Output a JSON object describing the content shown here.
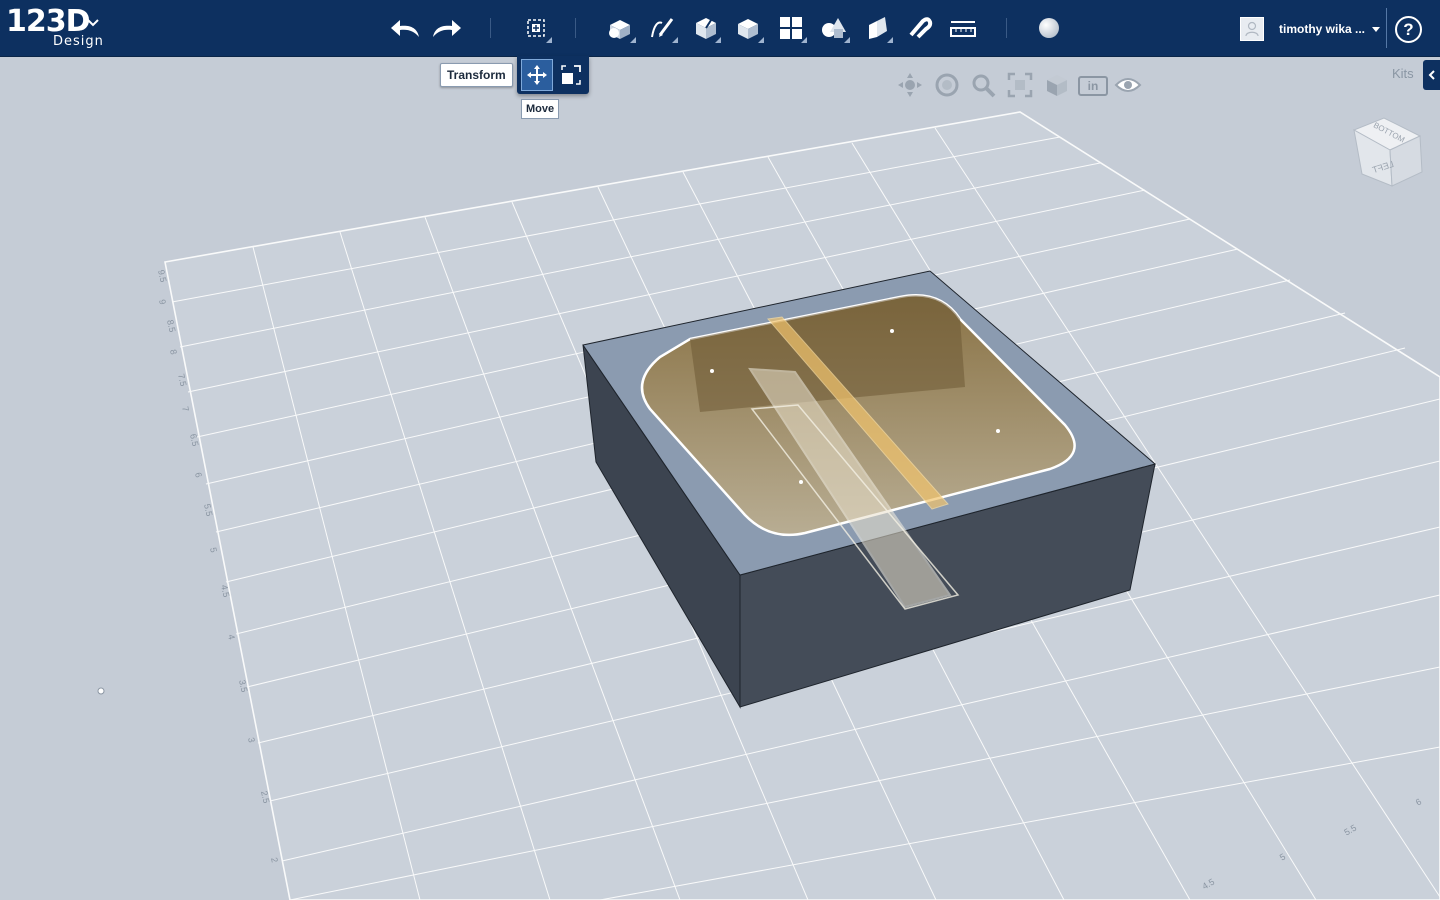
{
  "app": {
    "logo_main": "123D",
    "logo_sub": "Design",
    "logo_menu_icon": "chevron-down-icon"
  },
  "toolbar": {
    "tools": [
      {
        "id": "undo",
        "icon": "undo-icon"
      },
      {
        "id": "redo",
        "icon": "redo-icon"
      },
      {
        "id": "transform",
        "icon": "transform-icon"
      },
      {
        "id": "primitives",
        "icon": "primitives-icon"
      },
      {
        "id": "sketch",
        "icon": "sketch-icon"
      },
      {
        "id": "construct",
        "icon": "construct-icon"
      },
      {
        "id": "modify",
        "icon": "modify-icon"
      },
      {
        "id": "pattern",
        "icon": "pattern-icon"
      },
      {
        "id": "group",
        "icon": "group-icon"
      },
      {
        "id": "combine",
        "icon": "combine-icon"
      },
      {
        "id": "snap",
        "icon": "snap-icon"
      },
      {
        "id": "measure",
        "icon": "measure-icon"
      },
      {
        "id": "material",
        "icon": "material-icon"
      }
    ]
  },
  "transform_popup": {
    "tooltip": "Transform",
    "move_tooltip": "Move",
    "move_icon": "move-icon",
    "scale_icon": "scale-icon"
  },
  "user": {
    "name": "timothy wika ...",
    "avatar_icon": "avatar-icon"
  },
  "help": {
    "label": "?"
  },
  "view_tools": {
    "units": "in",
    "icons": [
      "pan-icon",
      "orbit-icon",
      "zoom-icon",
      "fit-icon",
      "view-style-icon",
      "eye-icon"
    ]
  },
  "kits": {
    "label": "Kits"
  },
  "viewcube": {
    "faces": [
      "BOTTOM",
      "LEFT"
    ]
  },
  "grid_labels": {
    "left_axis": [
      "9.5",
      "9",
      "8.5",
      "8",
      "7.5",
      "7",
      "6.5",
      "6",
      "5.5",
      "5",
      "4.5",
      "4",
      "3.5",
      "3",
      "2.5",
      "2"
    ],
    "bottom_axis": [
      "6",
      "5.5",
      "5",
      "4.5"
    ]
  },
  "colors": {
    "topbar": "#0d3060",
    "viewport_bg": "#c5ccd6",
    "grid_line": "#ffffff",
    "box_side": "#444c58",
    "box_top": "#8b9bb0",
    "pocket": "#a89a7c",
    "highlight": "#f2c46d"
  }
}
